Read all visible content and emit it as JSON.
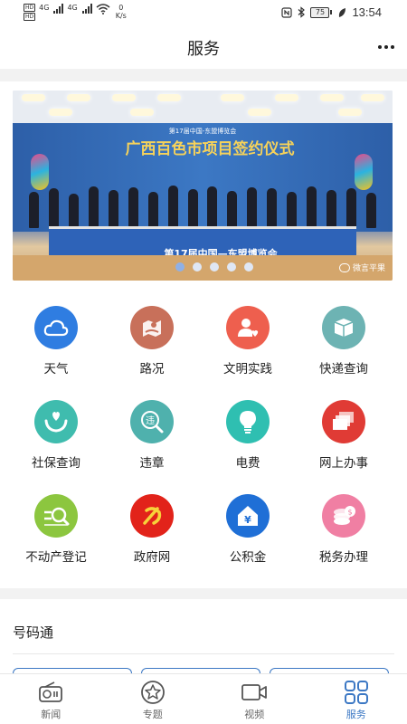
{
  "status_bar": {
    "hd1": "HD",
    "hd2": "HD",
    "net1": "4G",
    "net2": "4G",
    "speed_value": "0",
    "speed_unit": "K/s",
    "battery": "75",
    "time": "13:54"
  },
  "header": {
    "title": "服务"
  },
  "banner": {
    "backdrop_subtitle": "第17届中国-东盟博览会",
    "backdrop_title": "广西百色市项目签约仪式",
    "table_banner": "第17届中国—东盟博览会",
    "watermark": "微言平果",
    "slide_count": 5,
    "active_slide": 1
  },
  "services": [
    {
      "label": "天气",
      "icon": "cloud-icon",
      "color": "#2f7de1"
    },
    {
      "label": "路况",
      "icon": "map-icon",
      "color": "#c8705a"
    },
    {
      "label": "文明实践",
      "icon": "user-heart-icon",
      "color": "#ee5f4e"
    },
    {
      "label": "快递查询",
      "icon": "package-icon",
      "color": "#6db3b3"
    },
    {
      "label": "社保查询",
      "icon": "hands-heart-icon",
      "color": "#3fbcae"
    },
    {
      "label": "违章",
      "icon": "violation-search-icon",
      "color": "#4fb1ad"
    },
    {
      "label": "电费",
      "icon": "lightbulb-icon",
      "color": "#2fbfb1"
    },
    {
      "label": "网上办事",
      "icon": "windows-icon",
      "color": "#e03b35"
    },
    {
      "label": "不动产登记",
      "icon": "search-doc-icon",
      "color": "#8cc63f"
    },
    {
      "label": "政府网",
      "icon": "party-emblem-icon",
      "color": "#e2231a"
    },
    {
      "label": "公积金",
      "icon": "house-yuan-icon",
      "color": "#1f6fd6"
    },
    {
      "label": "税务办理",
      "icon": "coins-icon",
      "color": "#f07fa3"
    }
  ],
  "haomatong": {
    "title": "号码通"
  },
  "bottom_nav": [
    {
      "label": "新闻",
      "icon": "radio-icon",
      "active": false
    },
    {
      "label": "专题",
      "icon": "star-circle-icon",
      "active": false
    },
    {
      "label": "视频",
      "icon": "video-camera-icon",
      "active": false
    },
    {
      "label": "服务",
      "icon": "grid-apps-icon",
      "active": true
    }
  ],
  "colors": {
    "accent": "#3c78c4",
    "separator": "#f2f2f2"
  }
}
